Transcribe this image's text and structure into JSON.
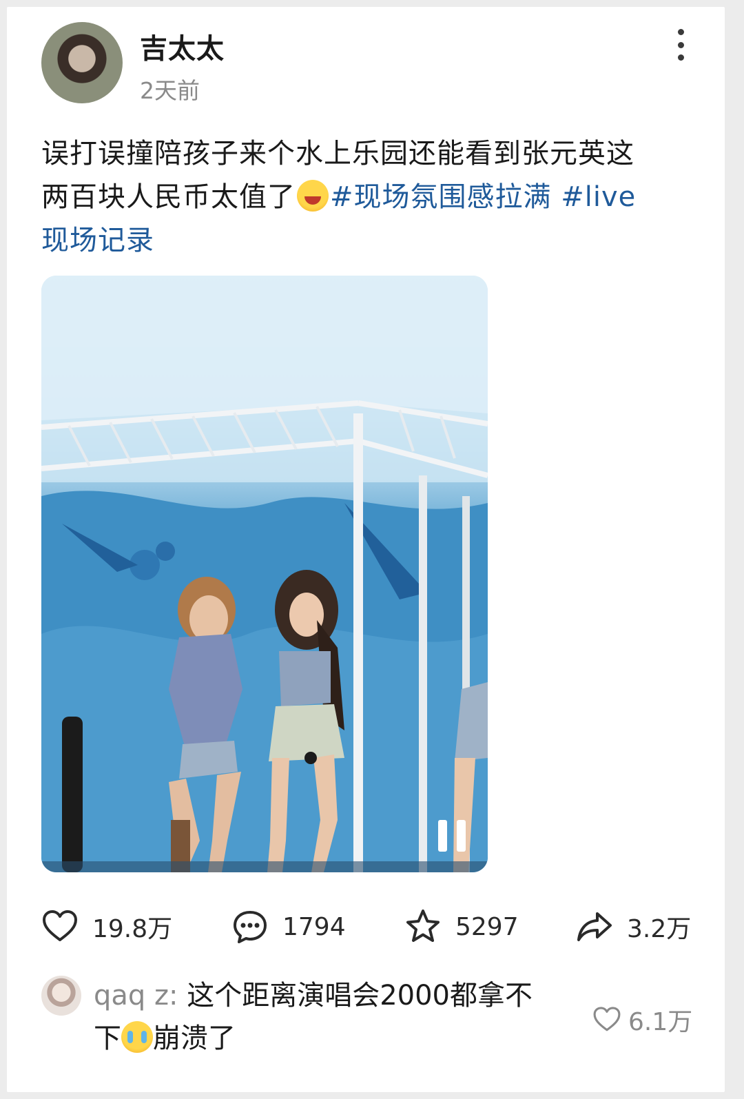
{
  "post": {
    "author": "吉太太",
    "time": "2天前",
    "text_line1": "误打误撞陪孩子来个水上乐园还能看到张元英这",
    "text_line2_plain": "两百块人民币太值了",
    "tag1": "#现场氛围感拉满",
    "tag2_part1": "#live",
    "tag2_part2": "现场记录",
    "emoji_icon": "grinning-squinting-face-icon"
  },
  "actions": {
    "likes": "19.8万",
    "comments": "1794",
    "favorites": "5297",
    "shares": "3.2万"
  },
  "comment": {
    "user": "qaq z:",
    "text_part1": "这个距离演唱会2000都拿不",
    "text_part2_before": "下",
    "text_part2_after": "崩溃了",
    "emoji_icon": "crying-face-icon",
    "likes": "6.1万"
  },
  "colors": {
    "tag": "#1f5a9a",
    "secondary_text": "#8a8a8a"
  }
}
